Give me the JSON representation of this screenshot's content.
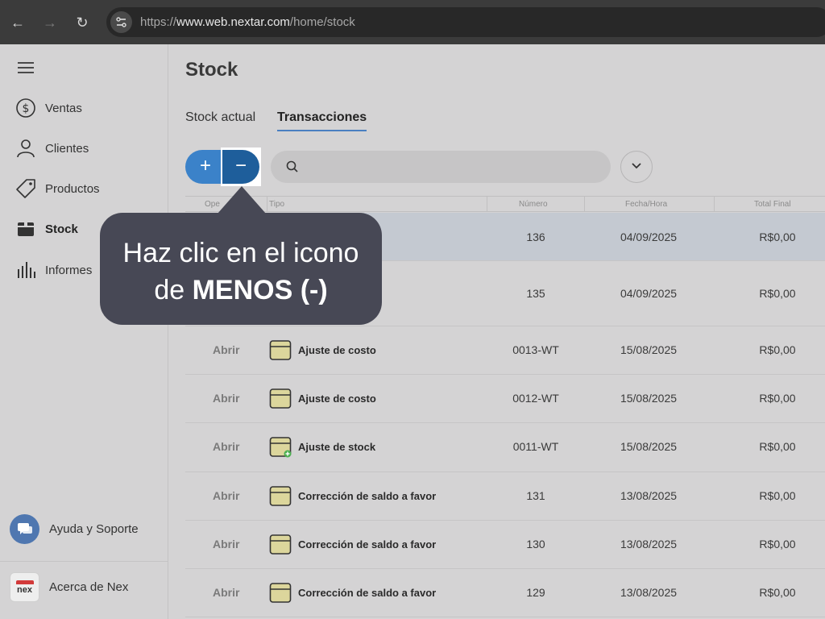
{
  "browser": {
    "url_prefix": "https://",
    "url_host": "www.web.nextar.com",
    "url_path": "/home/stock"
  },
  "sidebar": {
    "items": [
      {
        "label": "Ventas",
        "icon": "dollar-circle-icon"
      },
      {
        "label": "Clientes",
        "icon": "user-icon"
      },
      {
        "label": "Productos",
        "icon": "tag-icon"
      },
      {
        "label": "Stock",
        "icon": "box-icon",
        "active": true
      },
      {
        "label": "Informes",
        "icon": "bar-chart-icon"
      }
    ],
    "help_label": "Ayuda y Soporte",
    "about_label": "Acerca de Nex",
    "logo_text": "nex"
  },
  "main": {
    "title": "Stock",
    "tabs": [
      {
        "label": "Stock actual",
        "active": false
      },
      {
        "label": "Transacciones",
        "active": true
      }
    ],
    "plus_label": "+",
    "minus_label": "−"
  },
  "table": {
    "columns": [
      "Ope",
      "Tipo",
      "Número",
      "Fecha/Hora",
      "Total Final"
    ],
    "rows": [
      {
        "open": "Abrir",
        "type": "Ajuste de costo",
        "number": "0013-WT",
        "date": "15/08/2025",
        "total": "R$0,00",
        "icon": "box-icon"
      },
      {
        "open": "Abrir",
        "type": "Ajuste de costo",
        "number": "0012-WT",
        "date": "15/08/2025",
        "total": "R$0,00",
        "icon": "box-icon"
      },
      {
        "open": "Abrir",
        "type": "Ajuste de stock",
        "number": "0011-WT",
        "date": "15/08/2025",
        "total": "R$0,00",
        "icon": "box-plus-icon"
      },
      {
        "open": "Abrir",
        "type": "Corrección de saldo a favor",
        "number": "131",
        "date": "13/08/2025",
        "total": "R$0,00",
        "icon": "box-icon"
      },
      {
        "open": "Abrir",
        "type": "Corrección de saldo a favor",
        "number": "130",
        "date": "13/08/2025",
        "total": "R$0,00",
        "icon": "box-icon"
      },
      {
        "open": "Abrir",
        "type": "Corrección de saldo a favor",
        "number": "129",
        "date": "13/08/2025",
        "total": "R$0,00",
        "icon": "box-icon"
      }
    ],
    "partial_rows": [
      {
        "number": "136",
        "date": "04/09/2025",
        "total": "R$0,00"
      },
      {
        "number": "135",
        "date": "04/09/2025",
        "total": "R$0,00"
      }
    ]
  },
  "tooltip": {
    "line1": "Haz clic en el icono",
    "line2_prefix": "de ",
    "line2_bold": "MENOS (-)"
  },
  "colors": {
    "accent": "#3b82c9",
    "accent_dark": "#1e5e9b",
    "tooltip_bg": "#474855"
  }
}
